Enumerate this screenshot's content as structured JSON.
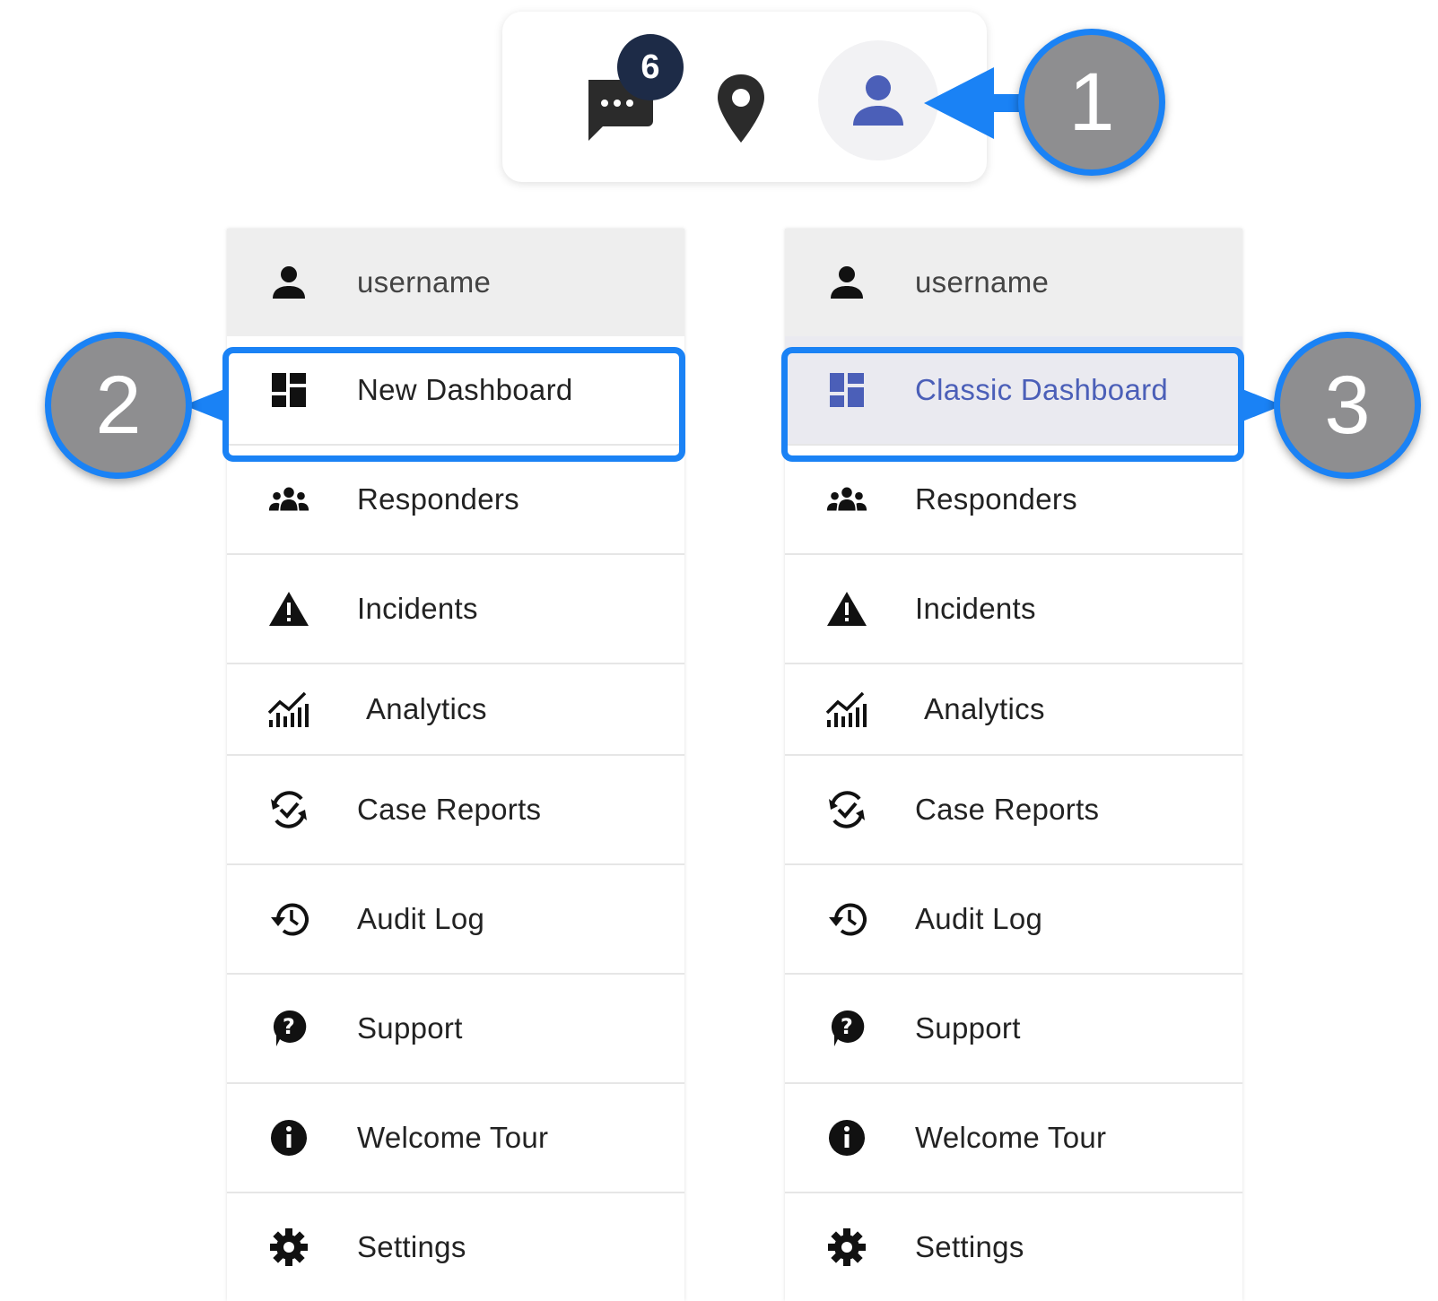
{
  "toolbar": {
    "chat_badge": "6",
    "icons": [
      "chat-icon",
      "location-pin-icon",
      "user-icon"
    ]
  },
  "menus": {
    "left": {
      "username": "username",
      "items": [
        "New Dashboard",
        "Responders",
        "Incidents",
        "Analytics",
        "Case Reports",
        "Audit Log",
        "Support",
        "Welcome Tour",
        "Settings"
      ]
    },
    "right": {
      "username": "username",
      "items": [
        "Classic Dashboard",
        "Responders",
        "Incidents",
        "Analytics",
        "Case Reports",
        "Audit Log",
        "Support",
        "Welcome Tour",
        "Settings"
      ]
    }
  },
  "callouts": [
    "1",
    "2",
    "3"
  ],
  "colors": {
    "highlight": "#1a82f5",
    "callout_fill": "#8e8e90",
    "active_text": "#4b5fb8",
    "badge": "#1d2b47",
    "avatar_icon": "#4b5fb8"
  }
}
